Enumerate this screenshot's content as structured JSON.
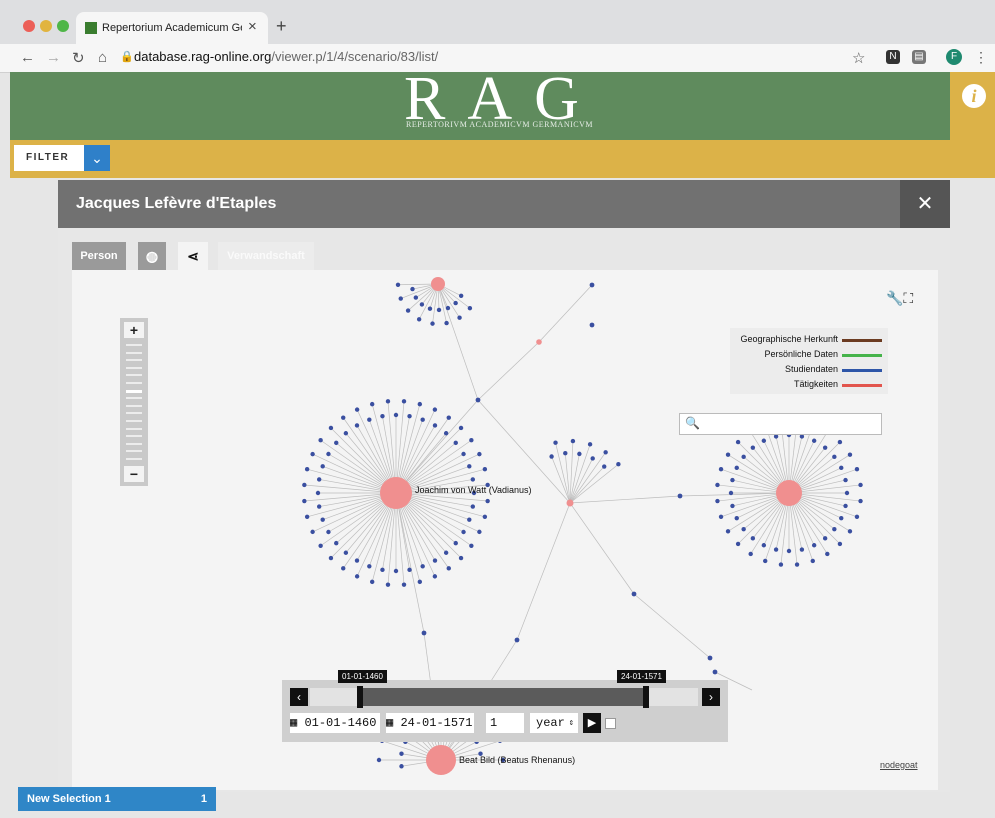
{
  "browser": {
    "tab_title": "Repertorium Academicum Germanicum",
    "new_tab": "+",
    "close": "×",
    "url_host": "database.rag-online.org",
    "url_path": "/viewer.p/1/4/scenario/83/list/",
    "profile_initial": "F"
  },
  "site": {
    "logo": "RAG",
    "logo_subtitle": "REPERTORIVM ACADEMICVM GERMANICVM",
    "filter_label": "FILTER"
  },
  "modal": {
    "title": "Jacques Lefèvre d'Etaples",
    "tabs": {
      "person": "Person",
      "relation": "Verwandschaft"
    }
  },
  "graph": {
    "legend": [
      {
        "label": "Geographische Herkunft",
        "color": "#6b3b21"
      },
      {
        "label": "Persönliche Daten",
        "color": "#45b34a"
      },
      {
        "label": "Studiendaten",
        "color": "#2e56a8"
      },
      {
        "label": "Tätigkeiten",
        "color": "#e2554d"
      }
    ],
    "node_labels": {
      "vadianus": "Joachim von Watt (Vadianus)",
      "rhenanus": "Beat Bild (Beatus Rhenanus)"
    },
    "node_color": "#f08f8f",
    "leaf_color": "#3a4fa0"
  },
  "timeline": {
    "start_tag": "01-01-1460",
    "end_tag": "24-01-1571",
    "start_date": "01-01-1460",
    "end_date": "24-01-1571",
    "step": "1",
    "unit": "year"
  },
  "credit": "nodegoat",
  "selection": {
    "name": "New Selection 1",
    "count": "1"
  }
}
